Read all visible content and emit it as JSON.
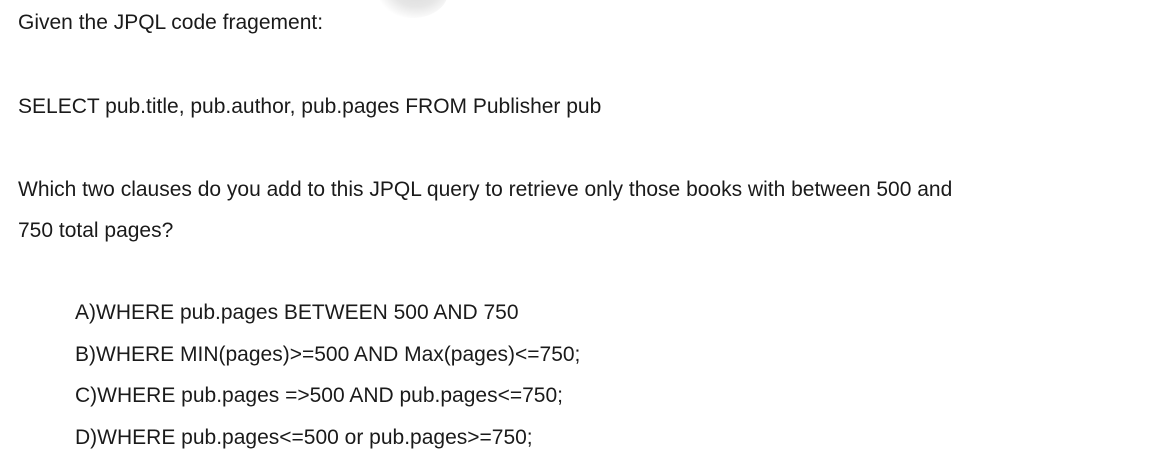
{
  "intro": "Given the JPQL code fragement:",
  "code": "SELECT pub.title, pub.author, pub.pages FROM Publisher pub",
  "question_line1": "Which two clauses do you add to this JPQL query to retrieve only those books with between 500 and",
  "question_line2": "750 total pages?",
  "options": [
    "A)WHERE pub.pages BETWEEN 500 AND 750",
    "B)WHERE MIN(pages)>=500 AND Max(pages)<=750;",
    "C)WHERE pub.pages =>500 AND pub.pages<=750;",
    "D)WHERE pub.pages<=500 or pub.pages>=750;"
  ]
}
